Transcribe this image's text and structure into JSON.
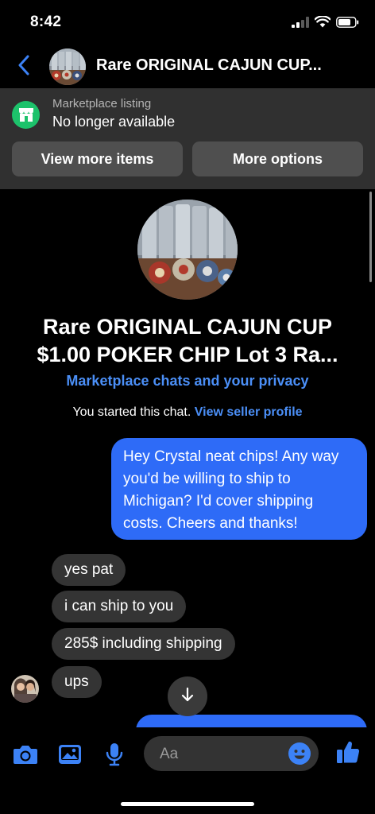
{
  "status_bar": {
    "time": "8:42"
  },
  "header": {
    "title": "Rare ORIGINAL CAJUN CUP..."
  },
  "listing": {
    "caption": "Marketplace listing",
    "status": "No longer available",
    "view_more_label": "View more items",
    "more_options_label": "More options"
  },
  "conversation": {
    "title_line1": "Rare ORIGINAL CAJUN CUP",
    "title_line2": "$1.00 POKER CHIP Lot 3 Ra...",
    "privacy_link": "Marketplace chats and your privacy",
    "started_text": "You started this chat.",
    "seller_profile_link": "View seller profile"
  },
  "messages": [
    {
      "from": "me",
      "text": "Hey Crystal neat chips! Any way you'd be willing to ship to Michigan? I'd cover shipping costs. Cheers and thanks!"
    },
    {
      "from": "seller",
      "text": "yes pat"
    },
    {
      "from": "seller",
      "text": "i can ship to you"
    },
    {
      "from": "seller",
      "text": "285$ including shipping"
    },
    {
      "from": "seller",
      "text": "ups"
    }
  ],
  "composer": {
    "placeholder": "Aa"
  },
  "colors": {
    "accent": "#2e6bf7",
    "link": "#4b8ff7",
    "store_green": "#1dc26b",
    "bubble_incoming": "#343434",
    "listing_panel": "#303030"
  },
  "icons": [
    "cellular-signal-icon",
    "wifi-icon",
    "battery-icon",
    "back-chevron-icon",
    "store-icon",
    "chevron-down-icon",
    "camera-icon",
    "photo-icon",
    "microphone-icon",
    "emoji-icon",
    "thumbs-up-icon"
  ]
}
